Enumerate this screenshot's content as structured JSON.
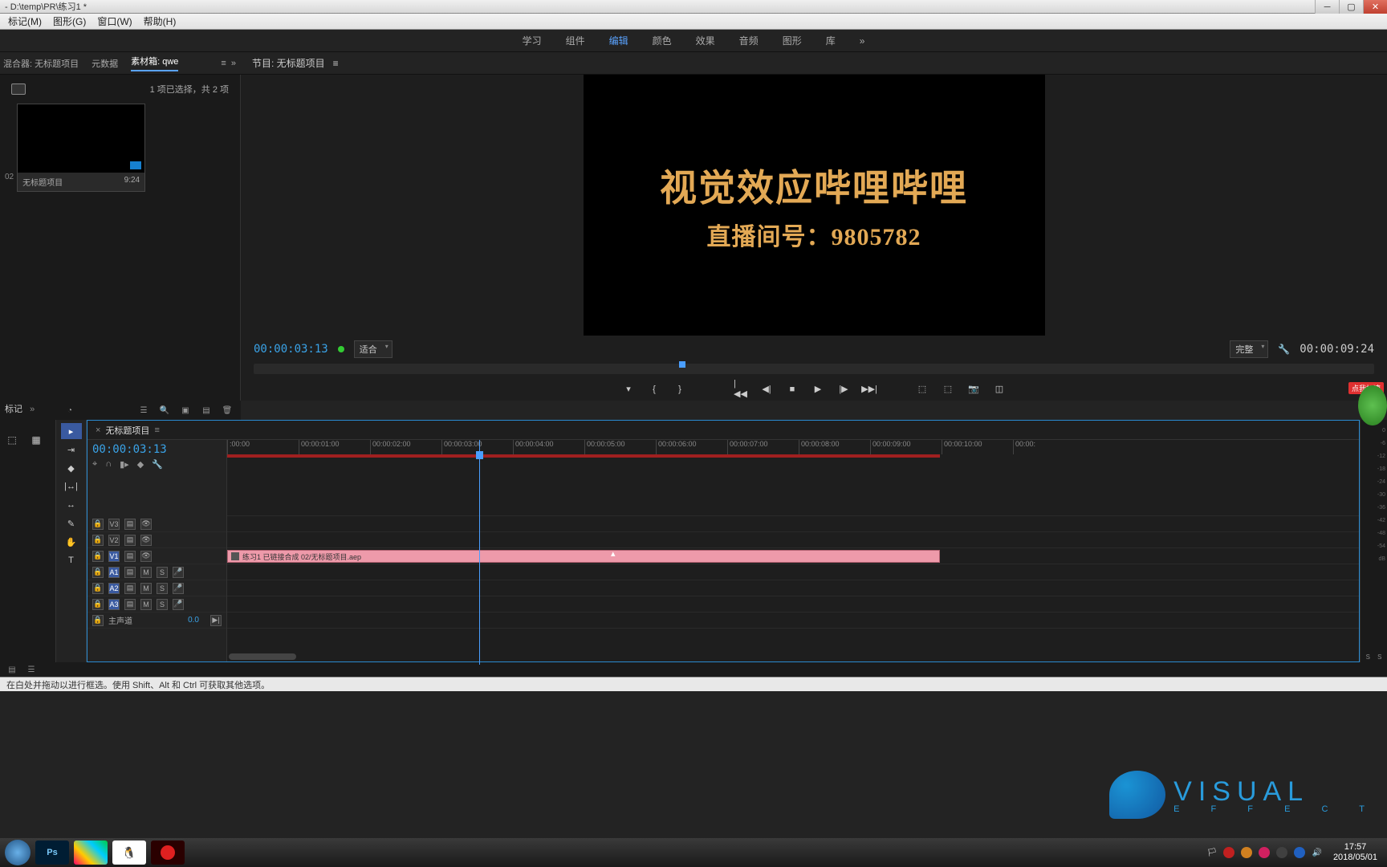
{
  "window": {
    "title": "- D:\\temp\\PR\\练习1 *"
  },
  "menubar": {
    "items": [
      "标记(M)",
      "图形(G)",
      "窗口(W)",
      "帮助(H)"
    ]
  },
  "workspace": {
    "tabs": [
      "学习",
      "组件",
      "编辑",
      "颜色",
      "效果",
      "音频",
      "图形",
      "库"
    ],
    "active_index": 2
  },
  "left_panel_tabs": {
    "items": [
      "混合器: 无标题项目",
      "元数据",
      "素材箱: qwe"
    ],
    "active_index": 2
  },
  "program_panel_tab": "节目: 无标题项目",
  "project": {
    "selection_text": "1 项已选择，共 2 项",
    "bin_item_label": "无标题项目",
    "bin_item_dur": "9:24",
    "row_prefix": "02"
  },
  "video_overlay": {
    "line1": "视觉效应哔哩哔哩",
    "line2": "直播间号：9805782"
  },
  "program": {
    "timecode_in": "00:00:03:13",
    "fit_label": "适合",
    "quality_label": "完整",
    "timecode_out": "00:00:09:24"
  },
  "timeline": {
    "tab": "无标题项目",
    "timecode": "00:00:03:13",
    "ruler": [
      ":00:00",
      "00:00:01:00",
      "00:00:02:00",
      "00:00:03:00",
      "00:00:04:00",
      "00:00:05:00",
      "00:00:06:00",
      "00:00:07:00",
      "00:00:08:00",
      "00:00:09:00",
      "00:00:10:00",
      "00:00:"
    ],
    "tracks": {
      "video": [
        "V3",
        "V2",
        "V1"
      ],
      "audio": [
        "A1",
        "A2",
        "A3"
      ],
      "master": "主声道",
      "master_val": "0.0"
    },
    "clip_name": "练习1 已链接合成 02/无标题项目.aep"
  },
  "lower_left_tab": "标记",
  "status": "在白处并拖动以进行框选。使用 Shift、Alt 和 Ctrl 可获取其他选项。",
  "watermark": {
    "brand": "VISUAL",
    "sub": "E F F E C T"
  },
  "float_label": "点我加速",
  "taskbar": {
    "time": "17:57",
    "date": "2018/05/01"
  },
  "audio_meter_labels": [
    "0",
    "-6",
    "-12",
    "-18",
    "-24",
    "-30",
    "-36",
    "-42",
    "-48",
    "-54",
    "dB"
  ],
  "solo_mute": {
    "s": "S"
  }
}
